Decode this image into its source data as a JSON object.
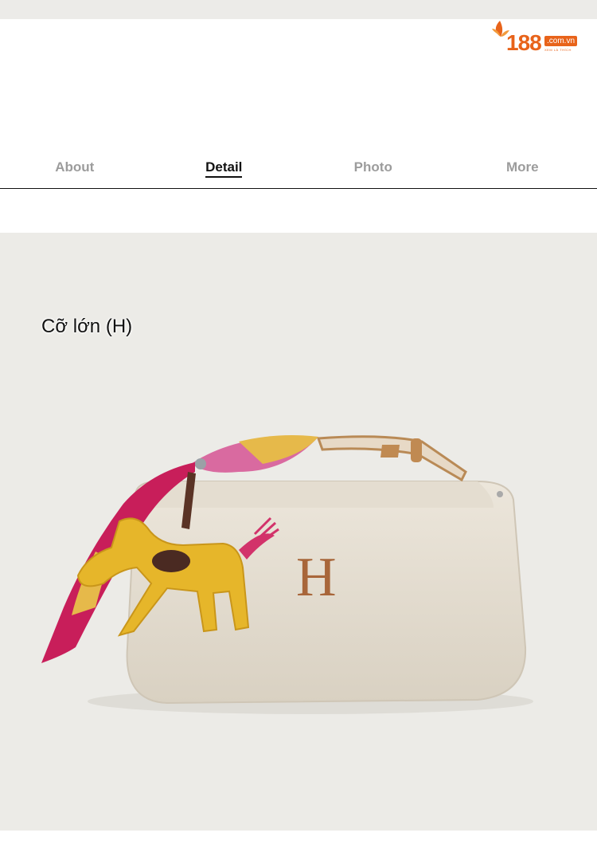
{
  "logo": {
    "number": "188",
    "domain": ".com.vn",
    "tagline": "XEM LÀ THÍCH"
  },
  "tabs": [
    {
      "label": "About",
      "active": false
    },
    {
      "label": "Detail",
      "active": true
    },
    {
      "label": "Photo",
      "active": false
    },
    {
      "label": "More",
      "active": false
    }
  ],
  "hero": {
    "size_label": "Cỡ lớn (H)",
    "emblem": "H"
  },
  "colors": {
    "brand": "#e8631a",
    "background": "#ecebe7",
    "canvas": "#e3dccf",
    "leather": "#e6b62a",
    "scarf": "#c81e5a"
  }
}
